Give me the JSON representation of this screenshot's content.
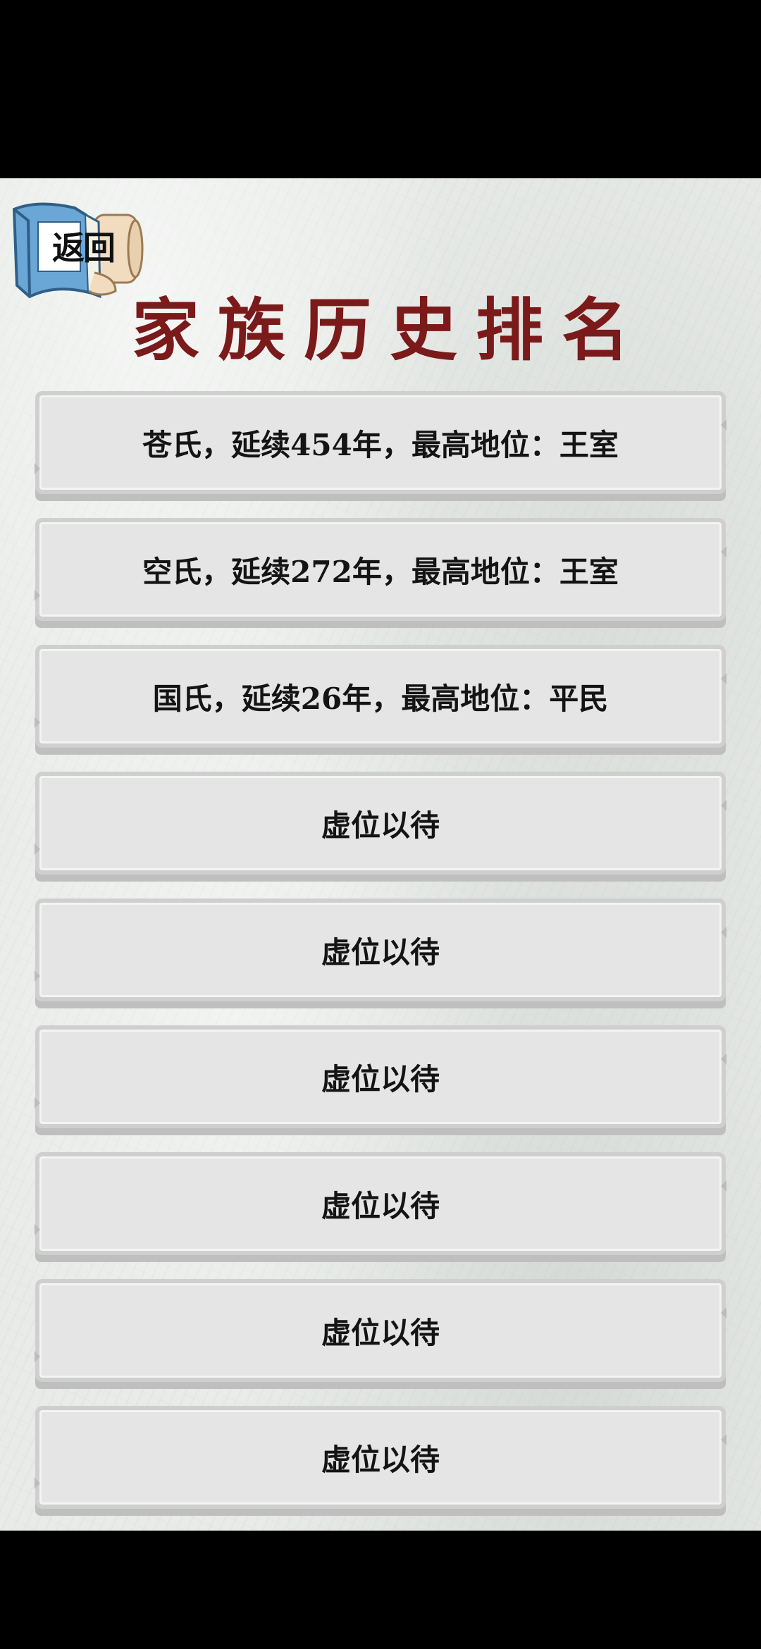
{
  "header": {
    "back_label": "返回",
    "title": "家族历史排名"
  },
  "ranking": [
    {
      "text": "苍氏，延续454年，最高地位：王室"
    },
    {
      "text": "空氏，延续272年，最高地位：王室"
    },
    {
      "text": "国氏，延续26年，最高地位：平民"
    },
    {
      "text": "虚位以待"
    },
    {
      "text": "虚位以待"
    },
    {
      "text": "虚位以待"
    },
    {
      "text": "虚位以待"
    },
    {
      "text": "虚位以待"
    },
    {
      "text": "虚位以待"
    }
  ],
  "colors": {
    "title": "#7a1a1a",
    "card_face": "#e5e5e5",
    "card_border": "#cfcfcf",
    "book_cover": "#6aa6d6",
    "background": "#e8ebe8"
  },
  "icons": {
    "back": "book-icon"
  }
}
